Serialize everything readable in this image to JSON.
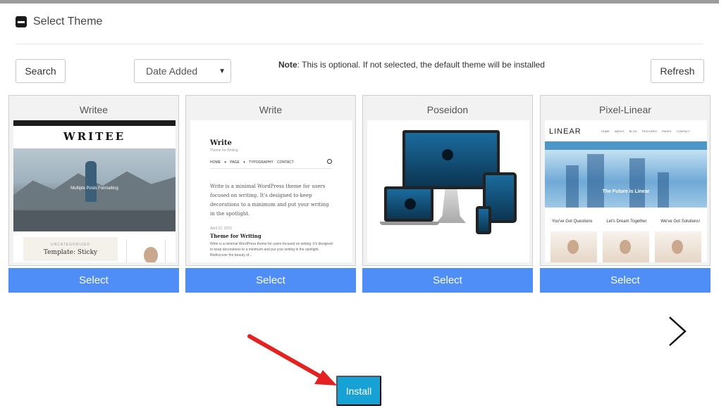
{
  "section": {
    "title": "Select Theme"
  },
  "toolbar": {
    "search_label": "Search",
    "sort_selected": "Date Added",
    "note_label": "Note",
    "note_text": ": This is optional. If not selected, the default theme will be installed",
    "refresh_label": "Refresh"
  },
  "themes": [
    {
      "name": "Writee",
      "select_label": "Select",
      "preview": {
        "logo": "WRITEE",
        "tagline": "Multiple Posts Formatting",
        "post_category": "UNCATEGORIZED",
        "post_title": "Template: Sticky"
      }
    },
    {
      "name": "Write",
      "select_label": "Select",
      "preview": {
        "site_title": "Write",
        "site_sub": "Theme for Writing",
        "menu": "HOME ▾ PAGE ▾ TYPOGRAPHY CONTACT",
        "intro": "Write is a minimal WordPress theme for users focused on writing. It's designed to keep decorations to a minimum and put your writing in the spotlight.",
        "post_date": "April 22, 2015",
        "post_title": "Theme for Writing",
        "excerpt": "Write is a minimal WordPress theme for users focused on writing. It's designed to keep decorations to a minimum and put your writing in the spotlight. Rediscover the beauty of..."
      }
    },
    {
      "name": "Poseidon",
      "select_label": "Select",
      "preview": {}
    },
    {
      "name": "Pixel-Linear",
      "select_label": "Select",
      "preview": {
        "logo": "LINEAR",
        "menu": "HOME ABOUT BLOG FEATURES PAGES CONTACT",
        "hero_text": "The Future is Linear",
        "cols": [
          "You've Got Questions",
          "Let's Dream Together",
          "We've Got Solutions!"
        ]
      }
    }
  ],
  "pager": {
    "next_icon": "chevron-right-icon"
  },
  "install": {
    "label": "Install"
  },
  "colors": {
    "select_bg": "#4f8ef7",
    "install_bg": "#17a2d6",
    "pointer": "#e52222"
  }
}
